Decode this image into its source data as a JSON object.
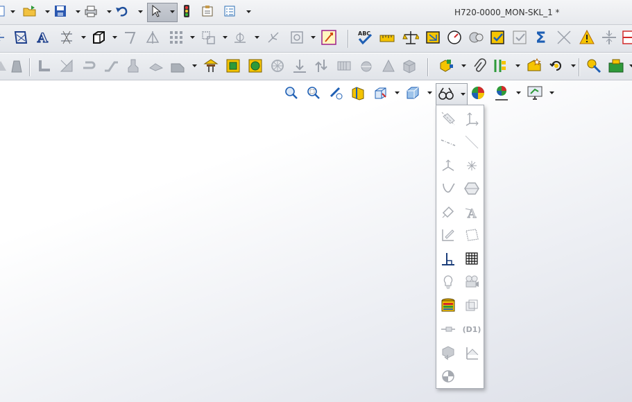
{
  "window": {
    "title": "H720-0000_MON-SKL_1 *"
  },
  "colors": {
    "accent_blue": "#1e5fb4",
    "yellow": "#f5c400",
    "green": "#2e9a3a",
    "red": "#d22a2a",
    "icon_gray": "#a6aab1"
  },
  "titlebar": {
    "icons": [
      "new-document-icon",
      "open-folder-icon",
      "save-icon",
      "print-icon",
      "undo-icon",
      "select-pointer-icon",
      "traffic-light-icon",
      "file-properties-icon",
      "options-icon"
    ]
  },
  "display_style_menu": {
    "open_button": "hide-show-items-icon",
    "items": [
      "axis-icon",
      "coordinate-system-icon",
      "centerline-icon",
      "temporary-axis-icon",
      "origin-icon",
      "points-icon",
      "curves-icon",
      "surface-icon",
      "dimension-icon",
      "annotation-icon",
      "sketch-icon",
      "plane-icon",
      "sketch-relations-icon",
      "grid-icon",
      "lights-icon",
      "cameras-icon",
      "decals-icon",
      "parts-icon",
      "weld-bead-icon",
      "d1-dimension-names-icon",
      "weld-gaps-icon",
      "routing-icon",
      "center-of-mass-icon"
    ],
    "dimension_names_label": "(D1)"
  }
}
